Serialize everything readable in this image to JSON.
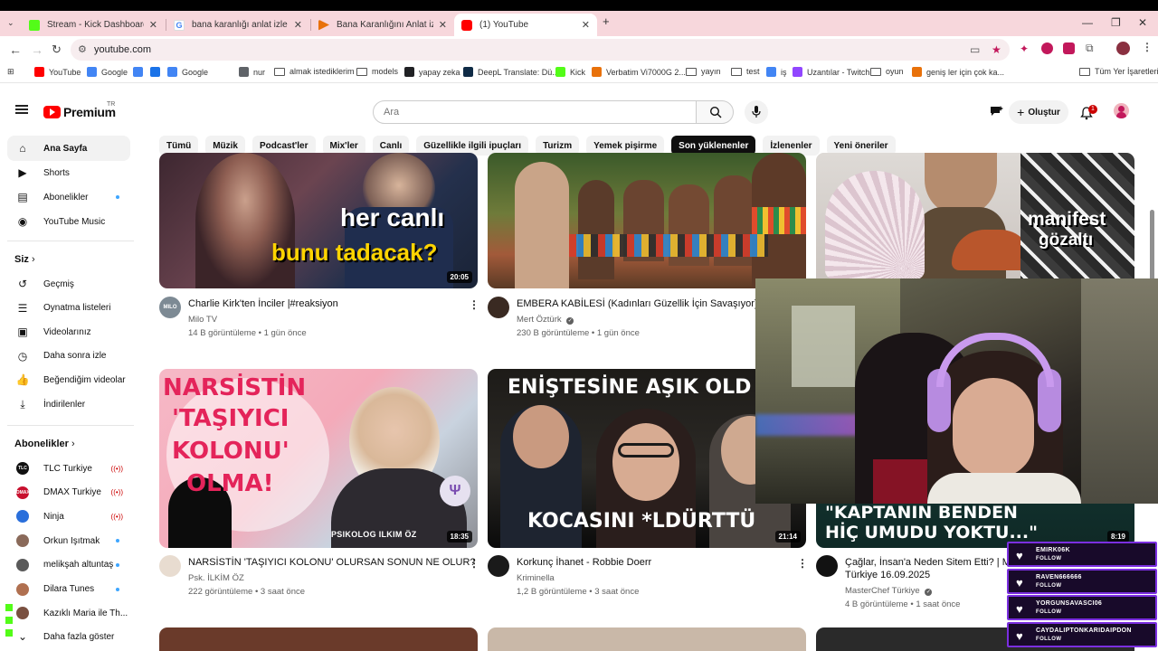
{
  "browser": {
    "tabs": [
      {
        "title": "Stream - Kick Dashboard",
        "color": "#53fc18"
      },
      {
        "title": "bana karanlığı anlat izle - Goog",
        "color": "#4285f4"
      },
      {
        "title": "Bana Karanlığını Anlat izle, Tell",
        "color": "#e8710a"
      },
      {
        "title": "(1) YouTube",
        "color": "#ff0000"
      }
    ],
    "new_tab": "+",
    "url": "youtube.com",
    "bookmarks": [
      {
        "label": "YouTube",
        "type": "site",
        "color": "#ff0000"
      },
      {
        "label": "Google",
        "type": "site",
        "color": "#4285f4"
      },
      {
        "label": "",
        "type": "site",
        "color": "#4285f4"
      },
      {
        "label": "",
        "type": "site",
        "color": "#1a73e8"
      },
      {
        "label": "Google",
        "type": "site",
        "color": "#4285f4"
      },
      {
        "label": "nur",
        "type": "site",
        "color": "#5f6368"
      },
      {
        "label": "almak istediklerim",
        "type": "folder"
      },
      {
        "label": "models",
        "type": "folder"
      },
      {
        "label": "yapay zeka",
        "type": "site",
        "color": "#202124"
      },
      {
        "label": "DeepL Translate: Dü...",
        "type": "site",
        "color": "#0f2b46"
      },
      {
        "label": "Kick",
        "type": "site",
        "color": "#53fc18"
      },
      {
        "label": "Verbatim Vi7000G 2...",
        "type": "site",
        "color": "#e8710a"
      },
      {
        "label": "yayın",
        "type": "folder"
      },
      {
        "label": "test",
        "type": "folder"
      },
      {
        "label": "iş",
        "type": "site",
        "color": "#4285f4"
      },
      {
        "label": "Uzantılar - Twitch",
        "type": "site",
        "color": "#9146ff"
      },
      {
        "label": "oyun",
        "type": "folder"
      },
      {
        "label": "geniş ler için çok ka...",
        "type": "site",
        "color": "#e8710a"
      }
    ],
    "all_bookmarks": "Tüm Yer İşaretleri"
  },
  "youtube": {
    "logo_word": "Premium",
    "logo_region": "TR",
    "search_placeholder": "Ara",
    "create_label": "Oluştur",
    "notif_count": "1",
    "chips": [
      "Tümü",
      "Müzik",
      "Podcast'ler",
      "Mix'ler",
      "Canlı",
      "Güzellikle ilgili ipuçları",
      "Turizm",
      "Yemek pişirme",
      "Son yüklenenler",
      "İzlenenler",
      "Yeni öneriler"
    ],
    "selected_chip": 8,
    "sidebar": {
      "main": [
        {
          "label": "Ana Sayfa",
          "icon": "home-icon",
          "active": true
        },
        {
          "label": "Shorts",
          "icon": "shorts-icon"
        },
        {
          "label": "Abonelikler",
          "icon": "subscriptions-icon",
          "dot": true
        },
        {
          "label": "YouTube Music",
          "icon": "youtube-music-icon"
        }
      ],
      "you_header": "Siz",
      "you": [
        {
          "label": "Geçmiş",
          "icon": "history-icon"
        },
        {
          "label": "Oynatma listeleri",
          "icon": "playlists-icon"
        },
        {
          "label": "Videolarınız",
          "icon": "your-videos-icon"
        },
        {
          "label": "Daha sonra izle",
          "icon": "watch-later-icon"
        },
        {
          "label": "Beğendiğim videolar",
          "icon": "liked-videos-icon"
        },
        {
          "label": "İndirilenler",
          "icon": "downloads-icon"
        }
      ],
      "subs_header": "Abonelikler",
      "subs": [
        {
          "label": "TLC Turkiye",
          "badge": "live",
          "color": "#111111",
          "abbr": "TLC"
        },
        {
          "label": "DMAX Turkiye",
          "badge": "live",
          "color": "#c8102e",
          "abbr": "DMAX"
        },
        {
          "label": "Ninja",
          "badge": "live",
          "color": "#2a6fdb",
          "abbr": ""
        },
        {
          "label": "Orkun Işıtmak",
          "badge": "dot",
          "color": "#8a6a5a",
          "abbr": ""
        },
        {
          "label": "melikşah altuntaş",
          "badge": "dot",
          "color": "#5a5a5a",
          "abbr": ""
        },
        {
          "label": "Dilara Tunes",
          "badge": "dot",
          "color": "#b07050",
          "abbr": ""
        },
        {
          "label": "Kazıklı Maria ile Th...",
          "badge": "",
          "color": "#7a5040",
          "abbr": ""
        }
      ],
      "show_more": "Daha fazla göster"
    },
    "videos": [
      {
        "title": "Charlie Kirk'ten İnciler |#reaksiyon",
        "channel": "Milo TV",
        "stats": "14 B görüntüleme • 1 gün önce",
        "duration": "20:05",
        "thumb_lines": [
          "her canlı",
          "bunu tadacak?"
        ],
        "avatar_text": "MILO",
        "verified": false
      },
      {
        "title": "EMBERA KABİLESİ (Kadınları Güzellik İçin Savaşıyor)",
        "channel": "Mert Öztürk",
        "stats": "230 B görüntüleme • 1 gün önce",
        "duration": "",
        "thumb_lines": [],
        "avatar_text": "",
        "verified": true
      },
      {
        "title": "",
        "channel": "",
        "stats": "",
        "duration": "",
        "thumb_lines": [
          "manifest",
          "gözaltı"
        ],
        "avatar_text": "",
        "verified": false
      },
      {
        "title": "NARSİSTİN 'TAŞIYICI KOLONU' OLURSAN SONUN NE OLUR?",
        "channel": "Psk. İLKİM ÖZ",
        "stats": "222 görüntüleme • 3 saat önce",
        "duration": "18:35",
        "thumb_lines": [
          "NARSİSTİN",
          "'TAŞIYICI",
          "KOLONU'",
          "OLMA!"
        ],
        "thumb_brand": "PSIKOLOG ILKIM ÖZ",
        "avatar_text": "",
        "verified": false
      },
      {
        "title": "Korkunç İhanet - Robbie Doerr",
        "channel": "Kriminella",
        "stats": "1,2 B görüntüleme • 3 saat önce",
        "duration": "21:14",
        "thumb_lines": [
          "ENİŞTESİNE AŞIK OLD",
          "KOCASINI *LDÜRTTÜ"
        ],
        "avatar_text": "",
        "verified": false
      },
      {
        "title": "Çağlar, İnsan'a Neden Sitem Etti? | Ma",
        "title2": "Türkiye 16.09.2025",
        "channel": "MasterChef Türkiye",
        "stats": "4 B görüntüleme • 1 saat önce",
        "duration": "8:19",
        "thumb_lines": [
          "\"KAPTANIN BENDEN",
          "HİÇ UMUDU YOKTU...\""
        ],
        "avatar_text": "",
        "verified": true
      }
    ]
  },
  "overlay": {
    "alerts": [
      {
        "name": "EMIRK06K",
        "action": "FOLLOW"
      },
      {
        "name": "RAVEN666666",
        "action": "FOLLOW"
      },
      {
        "name": "YORGUNSAVASCI06",
        "action": "FOLLOW"
      },
      {
        "name": "CAYDALIPTONKARIDAIPDON",
        "action": "FOLLOW"
      }
    ]
  }
}
